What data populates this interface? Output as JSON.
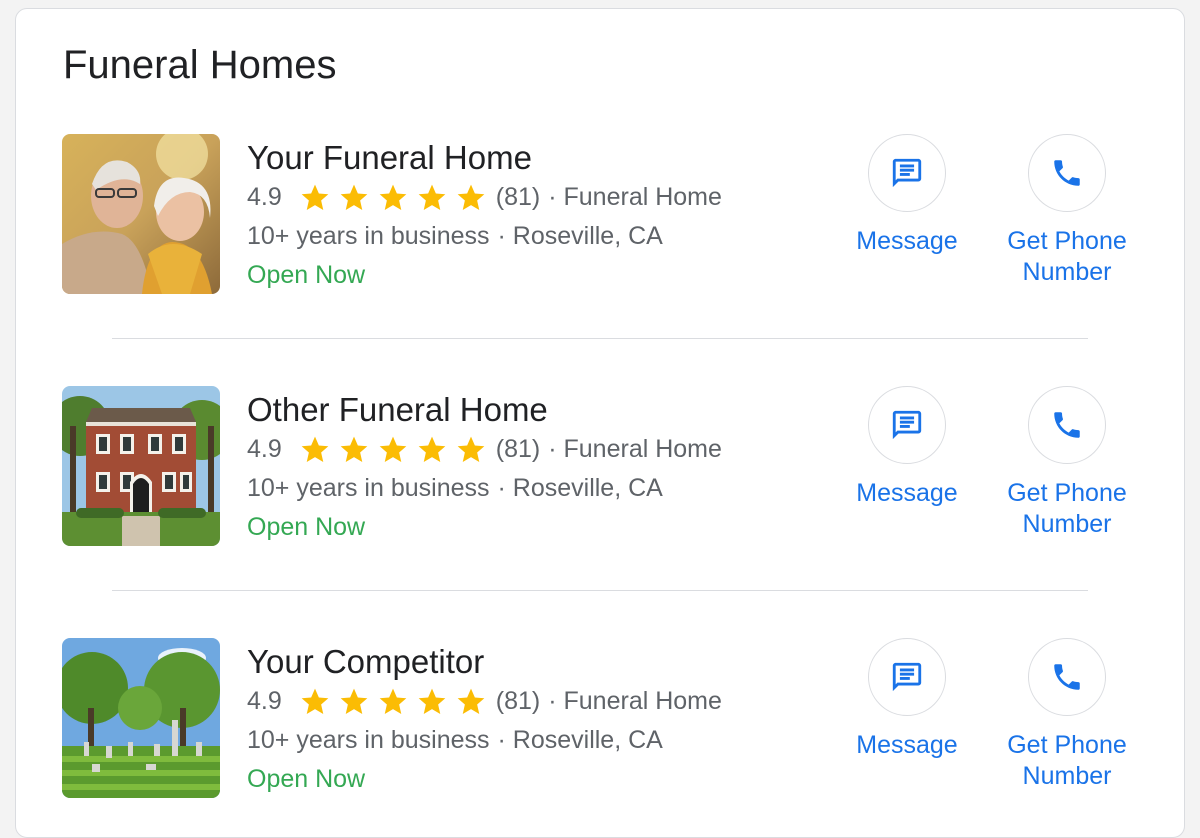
{
  "panel": {
    "title": "Funeral Homes"
  },
  "colors": {
    "accent": "#1a73e8",
    "open": "#34a853",
    "star": "#fbbc04",
    "muted": "#5f6368"
  },
  "listings": [
    {
      "name": "Your Funeral Home",
      "rating": "4.9",
      "stars": 5,
      "reviews": "(81)",
      "category": "· Funeral Home",
      "years": "10+ years in business",
      "location": "· Roseville, CA",
      "status": "Open Now",
      "message_label": "Message",
      "phone_label": "Get Phone Number",
      "image": "elderly-couple-photo"
    },
    {
      "name": "Other Funeral Home",
      "rating": "4.9",
      "stars": 5,
      "reviews": "(81)",
      "category": "· Funeral Home",
      "years": "10+ years in business",
      "location": "· Roseville, CA",
      "status": "Open Now",
      "message_label": "Message",
      "phone_label": "Get Phone Number",
      "image": "brick-building-photo"
    },
    {
      "name": "Your Competitor",
      "rating": "4.9",
      "stars": 5,
      "reviews": "(81)",
      "category": "· Funeral Home",
      "years": "10+ years in business",
      "location": "· Roseville, CA",
      "status": "Open Now",
      "message_label": "Message",
      "phone_label": "Get Phone Number",
      "image": "cemetery-photo"
    }
  ]
}
